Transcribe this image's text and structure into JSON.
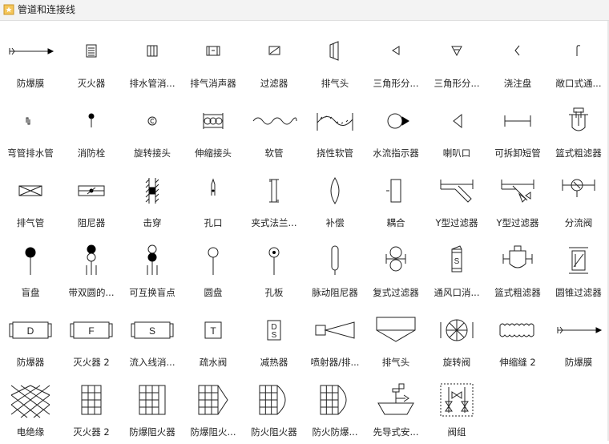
{
  "title": "管道和连接线",
  "rows": [
    [
      {
        "label": "防爆膜",
        "icon": "burst-membrane-icon"
      },
      {
        "label": "灭火器",
        "icon": "extinguisher-icon"
      },
      {
        "label": "排水管消...",
        "icon": "drain-silencer-icon"
      },
      {
        "label": "排气消声器",
        "icon": "exhaust-silencer-icon"
      },
      {
        "label": "过滤器",
        "icon": "filter-icon"
      },
      {
        "label": "排气头",
        "icon": "exhaust-head-icon"
      },
      {
        "label": "三角形分...",
        "icon": "triangle-left-icon"
      },
      {
        "label": "三角形分...",
        "icon": "triangle-down-icon"
      },
      {
        "label": "浇注盘",
        "icon": "pour-pan-icon"
      },
      {
        "label": "敞口式通...",
        "icon": "open-vent-icon"
      }
    ],
    [
      {
        "label": "弯管排水管",
        "icon": "bend-drain-icon"
      },
      {
        "label": "消防栓",
        "icon": "hydrant-icon"
      },
      {
        "label": "旋转接头",
        "icon": "rotary-joint-icon"
      },
      {
        "label": "伸缩接头",
        "icon": "expansion-joint-icon"
      },
      {
        "label": "软管",
        "icon": "hose-icon"
      },
      {
        "label": "挠性软管",
        "icon": "flexible-hose-icon"
      },
      {
        "label": "水流指示器",
        "icon": "flow-indicator-icon"
      },
      {
        "label": "喇叭口",
        "icon": "bell-mouth-icon"
      },
      {
        "label": "可拆卸短管",
        "icon": "spool-piece-icon"
      },
      {
        "label": "篮式粗滤器",
        "icon": "basket-strainer-icon"
      }
    ],
    [
      {
        "label": "排气管",
        "icon": "exhaust-pipe-icon"
      },
      {
        "label": "阻尼器",
        "icon": "damper-icon"
      },
      {
        "label": "击穿",
        "icon": "breakthrough-icon"
      },
      {
        "label": "孔口",
        "icon": "orifice-icon"
      },
      {
        "label": "夹式法兰...",
        "icon": "clamp-flange-icon"
      },
      {
        "label": "补偿",
        "icon": "compensator-icon"
      },
      {
        "label": "耦合",
        "icon": "coupling-icon"
      },
      {
        "label": "Y型过滤器",
        "icon": "y-strainer-icon"
      },
      {
        "label": "Y型过滤器",
        "icon": "y-strainer-valve-icon"
      },
      {
        "label": "分流阀",
        "icon": "diverter-valve-icon"
      }
    ],
    [
      {
        "label": "盲盘",
        "icon": "blind-disc-icon"
      },
      {
        "label": "带双圆的...",
        "icon": "double-circle-icon"
      },
      {
        "label": "可互换盲点",
        "icon": "interchangeable-blind-icon"
      },
      {
        "label": "圆盘",
        "icon": "disc-icon"
      },
      {
        "label": "孔板",
        "icon": "orifice-plate-icon"
      },
      {
        "label": "脉动阻尼器",
        "icon": "pulsation-damper-icon"
      },
      {
        "label": "复式过滤器",
        "icon": "duplex-filter-icon"
      },
      {
        "label": "通风口消...",
        "icon": "vent-silencer-icon"
      },
      {
        "label": "篮式粗滤器",
        "icon": "basket-strainer-2-icon"
      },
      {
        "label": "圆锥过滤器",
        "icon": "cone-filter-icon"
      }
    ],
    [
      {
        "label": "防爆器",
        "icon": "explosion-proof-icon",
        "letter": "D"
      },
      {
        "label": "灭火器 2",
        "icon": "extinguisher-2-icon",
        "letter": "F"
      },
      {
        "label": "流入线消...",
        "icon": "inflow-silencer-icon",
        "letter": "S"
      },
      {
        "label": "疏水阀",
        "icon": "steam-trap-icon",
        "letter": "T"
      },
      {
        "label": "减热器",
        "icon": "desuperheater-icon",
        "letter": "DS"
      },
      {
        "label": "喷射器/排...",
        "icon": "ejector-icon"
      },
      {
        "label": "排气头",
        "icon": "exhaust-hood-icon"
      },
      {
        "label": "旋转阀",
        "icon": "rotary-valve-icon"
      },
      {
        "label": "伸缩缝 2",
        "icon": "expansion-joint-2-icon"
      },
      {
        "label": "防爆膜",
        "icon": "burst-membrane-2-icon"
      }
    ],
    [
      {
        "label": "电绝缘",
        "icon": "electric-insulation-icon"
      },
      {
        "label": "灭火器 2",
        "icon": "flame-arrester-icon"
      },
      {
        "label": "防爆阻火器",
        "icon": "explosion-arrester-icon"
      },
      {
        "label": "防爆阻火...",
        "icon": "explosion-arrester-2-icon"
      },
      {
        "label": "防火阻火器",
        "icon": "fire-arrester-icon"
      },
      {
        "label": "防火防爆...",
        "icon": "fire-explosion-arrester-icon"
      },
      {
        "label": "先导式安...",
        "icon": "pilot-safety-valve-icon"
      },
      {
        "label": "阀组",
        "icon": "valve-group-icon"
      }
    ]
  ]
}
